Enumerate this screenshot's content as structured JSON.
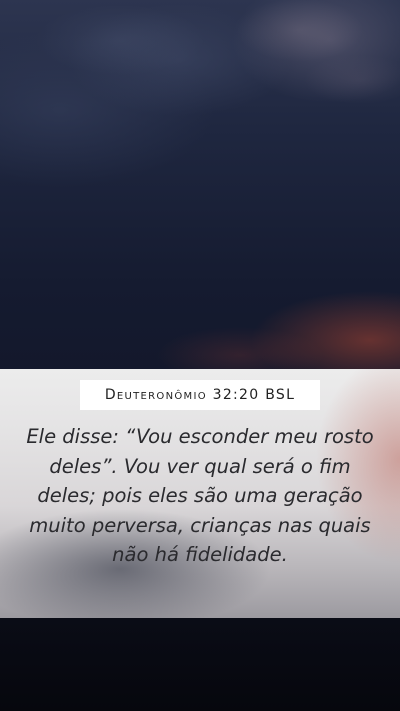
{
  "reference": "Deuteronômio 32:20 BSL",
  "verse": "Ele disse: “Vou esconder meu rosto deles”. Vou ver qual será o fim deles; pois eles são uma geração muito perversa, crianças nas quais não há fidelidade."
}
